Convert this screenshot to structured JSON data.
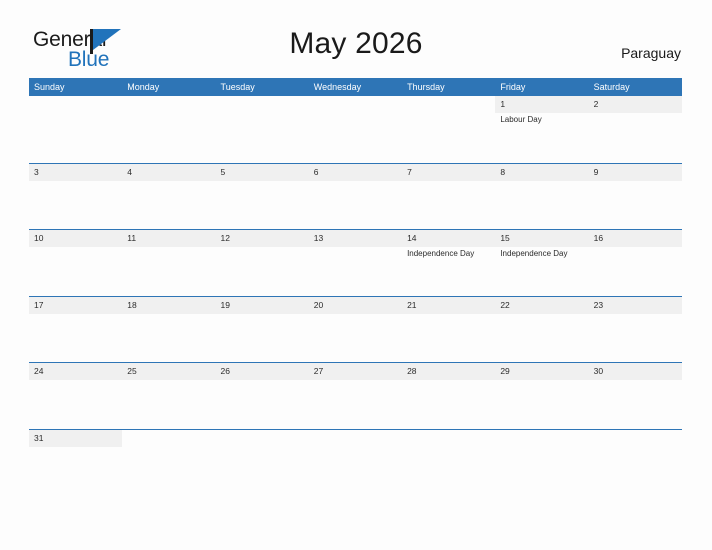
{
  "brand": {
    "name_part1": "General",
    "name_part2": "Blue",
    "flag_icon": "blue-flag-triangle-icon",
    "color_dark": "#1b1b1b",
    "color_blue": "#2173bb"
  },
  "header": {
    "title": "May 2026",
    "country": "Paraguay"
  },
  "calendar": {
    "month": "May",
    "year": "2026",
    "accent_color": "#2e75b6",
    "band_color": "#f0f0f0",
    "weekdays": [
      "Sunday",
      "Monday",
      "Tuesday",
      "Wednesday",
      "Thursday",
      "Friday",
      "Saturday"
    ],
    "weeks": [
      [
        {
          "num": "",
          "event": ""
        },
        {
          "num": "",
          "event": ""
        },
        {
          "num": "",
          "event": ""
        },
        {
          "num": "",
          "event": ""
        },
        {
          "num": "",
          "event": ""
        },
        {
          "num": "1",
          "event": "Labour Day"
        },
        {
          "num": "2",
          "event": ""
        }
      ],
      [
        {
          "num": "3",
          "event": ""
        },
        {
          "num": "4",
          "event": ""
        },
        {
          "num": "5",
          "event": ""
        },
        {
          "num": "6",
          "event": ""
        },
        {
          "num": "7",
          "event": ""
        },
        {
          "num": "8",
          "event": ""
        },
        {
          "num": "9",
          "event": ""
        }
      ],
      [
        {
          "num": "10",
          "event": ""
        },
        {
          "num": "11",
          "event": ""
        },
        {
          "num": "12",
          "event": ""
        },
        {
          "num": "13",
          "event": ""
        },
        {
          "num": "14",
          "event": "Independence Day"
        },
        {
          "num": "15",
          "event": "Independence Day"
        },
        {
          "num": "16",
          "event": ""
        }
      ],
      [
        {
          "num": "17",
          "event": ""
        },
        {
          "num": "18",
          "event": ""
        },
        {
          "num": "19",
          "event": ""
        },
        {
          "num": "20",
          "event": ""
        },
        {
          "num": "21",
          "event": ""
        },
        {
          "num": "22",
          "event": ""
        },
        {
          "num": "23",
          "event": ""
        }
      ],
      [
        {
          "num": "24",
          "event": ""
        },
        {
          "num": "25",
          "event": ""
        },
        {
          "num": "26",
          "event": ""
        },
        {
          "num": "27",
          "event": ""
        },
        {
          "num": "28",
          "event": ""
        },
        {
          "num": "29",
          "event": ""
        },
        {
          "num": "30",
          "event": ""
        }
      ],
      [
        {
          "num": "31",
          "event": ""
        },
        {
          "num": "",
          "event": ""
        },
        {
          "num": "",
          "event": ""
        },
        {
          "num": "",
          "event": ""
        },
        {
          "num": "",
          "event": ""
        },
        {
          "num": "",
          "event": ""
        },
        {
          "num": "",
          "event": ""
        }
      ]
    ]
  }
}
